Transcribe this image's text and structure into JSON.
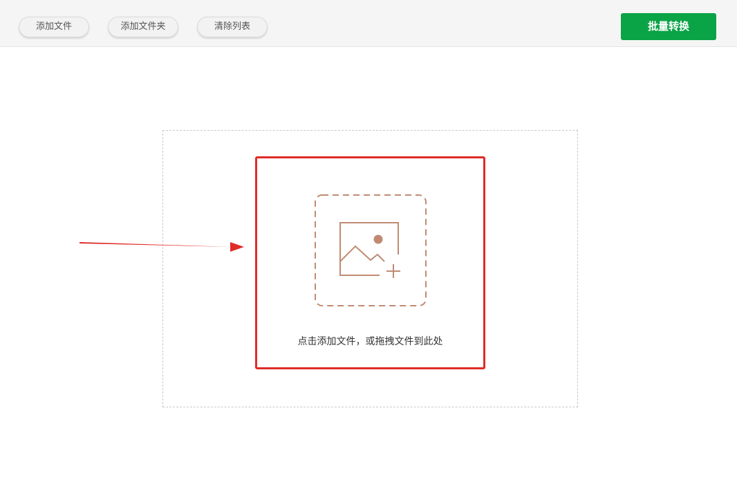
{
  "toolbar": {
    "add_file_label": "添加文件",
    "add_folder_label": "添加文件夹",
    "clear_list_label": "清除列表",
    "batch_convert_label": "批量转换"
  },
  "drop_zone": {
    "hint": "点击添加文件，或拖拽文件到此处",
    "icon": "image-add-icon"
  },
  "annotation": {
    "arrow_icon": "red-arrow-icon"
  },
  "colors": {
    "accent_green": "#0aa346",
    "highlight_red": "#e02b27",
    "icon_brown": "#c08a72"
  }
}
